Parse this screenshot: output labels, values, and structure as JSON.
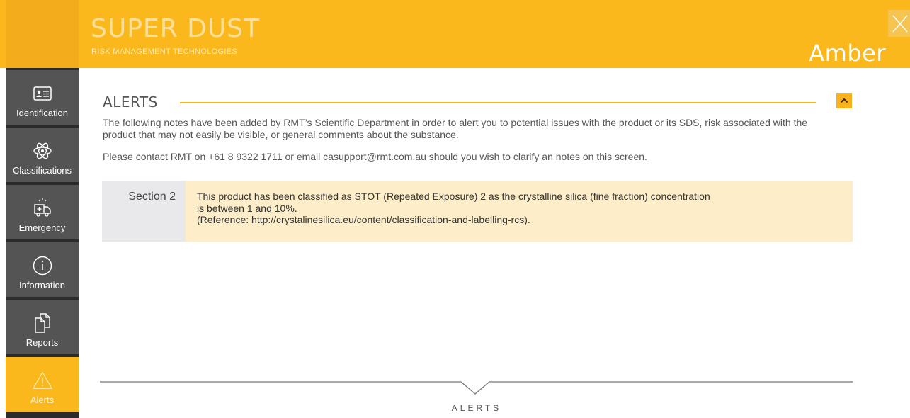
{
  "header": {
    "product_name": "SUPER DUST",
    "subtitle": "RISK MANAGEMENT TECHNOLOGIES",
    "status": "Amber",
    "accent_color": "#fbb81c",
    "close_icon": "close-icon"
  },
  "sidebar": {
    "items": [
      {
        "label": "Identification",
        "icon": "id-card-icon"
      },
      {
        "label": "Classifications",
        "icon": "atom-icon"
      },
      {
        "label": "Emergency",
        "icon": "ambulance-icon"
      },
      {
        "label": "Information",
        "icon": "info-icon"
      },
      {
        "label": "Reports",
        "icon": "documents-icon"
      },
      {
        "label": "Alerts",
        "icon": "warning-icon",
        "active": true
      }
    ]
  },
  "main": {
    "heading": "ALERTS",
    "intro": "The following notes have been added by RMT’s Scientific Department in order to alert you to potential issues with the product or its SDS, risk associated with the product that may not easily be visible, or general comments about the substance.",
    "contact": "Please contact RMT on +61 8 9322 1711 or email casupport@rmt.com.au should you wish to clarify an notes on this screen.",
    "alerts": [
      {
        "section": "Section 2",
        "line1": "This product has been classified as STOT (Repeated Exposure) 2 as the crystalline silica (fine fraction) concentration",
        "line2": "is between 1 and 10%.",
        "line3": "(Reference: http://crystalinesilica.eu/content/classification-and-labelling-rcs)."
      }
    ]
  },
  "footer": {
    "label": "ALERTS"
  }
}
